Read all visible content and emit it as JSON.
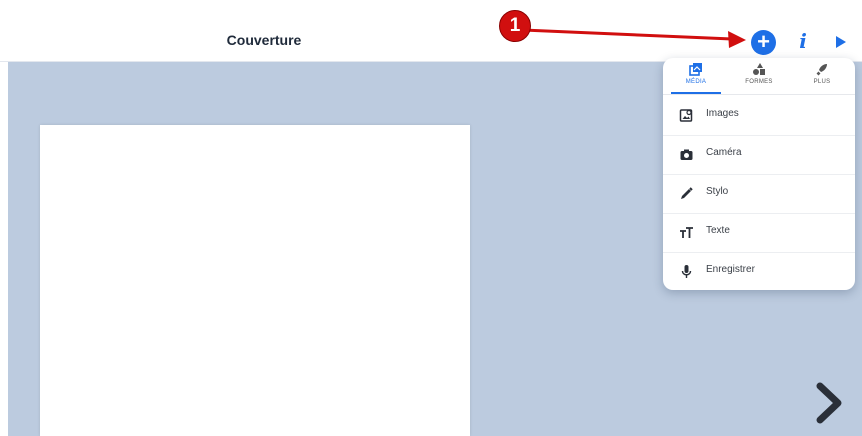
{
  "header": {
    "title": "Couverture",
    "add_icon": "plus-circle-icon",
    "info_icon": "info-icon",
    "play_icon": "play-icon"
  },
  "callout": {
    "number": "1",
    "color": "#d10f0f"
  },
  "popup": {
    "tabs": [
      {
        "label": "MÉDIA",
        "icon": "media-icon",
        "active": true
      },
      {
        "label": "FORMES",
        "icon": "shapes-icon",
        "active": false
      },
      {
        "label": "PLUS",
        "icon": "rocket-icon",
        "active": false
      }
    ],
    "items": [
      {
        "label": "Images",
        "icon": "image-icon"
      },
      {
        "label": "Caméra",
        "icon": "camera-icon"
      },
      {
        "label": "Stylo",
        "icon": "pen-icon"
      },
      {
        "label": "Texte",
        "icon": "text-icon"
      },
      {
        "label": "Enregistrer",
        "icon": "microphone-icon"
      }
    ]
  },
  "navigation": {
    "next_icon": "chevron-right-icon"
  },
  "colors": {
    "accent": "#1e6fe6",
    "workspace": "#bccbdf",
    "page": "#ffffff"
  }
}
